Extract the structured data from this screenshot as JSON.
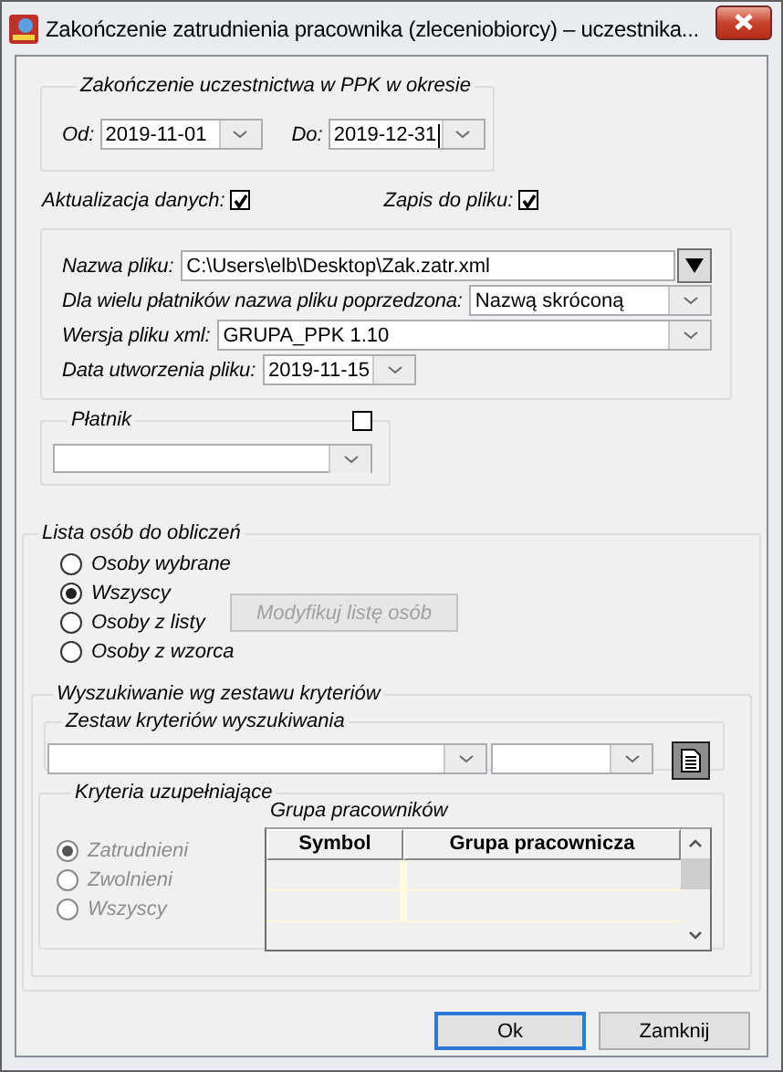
{
  "window": {
    "title": "Zakończenie zatrudnienia pracownika (zleceniobiorcy) – uczestnika..."
  },
  "period": {
    "legend": "Zakończenie uczestnictwa w PPK w okresie",
    "from_label": "Od:",
    "from_value": "2019-11-01",
    "to_label": "Do:",
    "to_value": "2019-12-31"
  },
  "options": [
    {
      "label": "Aktualizacja danych:",
      "checked": true
    },
    {
      "label": "Zapis do pliku:",
      "checked": true
    }
  ],
  "file": [
    {
      "kind": "path",
      "label": "Nazwa pliku:",
      "value": "C:\\Users\\elb\\Desktop\\Zak.zatr.xml"
    },
    {
      "kind": "select",
      "label": "Dla wielu płatników nazwa pliku poprzedzona:",
      "value": "Nazwą skróconą"
    },
    {
      "kind": "select",
      "label": "Wersja pliku xml:",
      "value": "GRUPA_PPK 1.10"
    },
    {
      "kind": "date",
      "label": "Data utworzenia pliku:",
      "value": "2019-11-15"
    }
  ],
  "payer": {
    "legend": "Płatnik",
    "checked": false
  },
  "people": {
    "legend": "Lista osób do obliczeń",
    "choices": [
      {
        "label": "Osoby wybrane",
        "selected": false
      },
      {
        "label": "Wszyscy",
        "selected": true
      },
      {
        "label": "Osoby z listy",
        "selected": false
      },
      {
        "label": "Osoby z wzorca",
        "selected": false
      }
    ],
    "modify_button": {
      "label": "Modyfikuj listę osób",
      "disabled": true
    },
    "search": {
      "legend": "Wyszukiwanie wg zestawu kryteriów",
      "criteria_set": {
        "legend": "Zestaw kryteriów wyszukiwania"
      },
      "extra": {
        "legend": "Kryteria uzupełniające",
        "disabled": true,
        "choices": [
          {
            "label": "Zatrudnieni",
            "selected": true
          },
          {
            "label": "Zwolnieni",
            "selected": false
          },
          {
            "label": "Wszyscy",
            "selected": false
          }
        ],
        "group_label": "Grupa pracowników",
        "columns": [
          "Symbol",
          "Grupa pracownicza"
        ]
      }
    }
  },
  "buttons": [
    {
      "label": "Ok",
      "default": true
    },
    {
      "label": "Zamknij",
      "default": false
    }
  ]
}
